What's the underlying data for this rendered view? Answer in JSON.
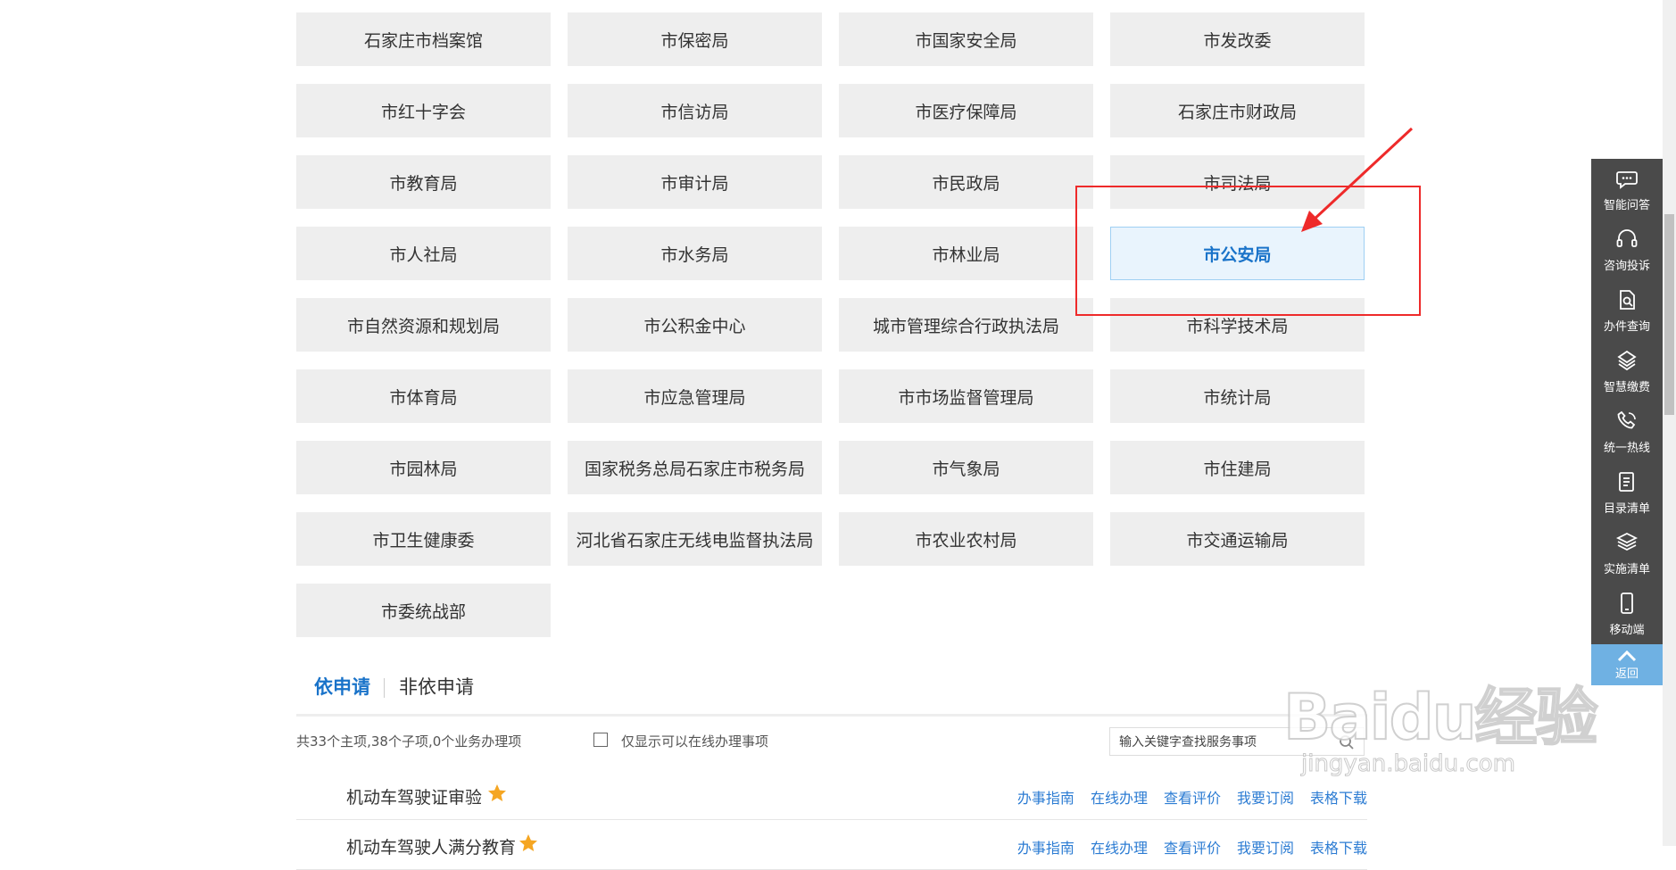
{
  "departments": [
    "石家庄市档案馆",
    "市保密局",
    "市国家安全局",
    "市发改委",
    "市红十字会",
    "市信访局",
    "市医疗保障局",
    "石家庄市财政局",
    "市教育局",
    "市审计局",
    "市民政局",
    "市司法局",
    "市人社局",
    "市水务局",
    "市林业局",
    "市公安局",
    "市自然资源和规划局",
    "市公积金中心",
    "城市管理综合行政执法局",
    "市科学技术局",
    "市体育局",
    "市应急管理局",
    "市市场监督管理局",
    "市统计局",
    "市园林局",
    "国家税务总局石家庄市税务局",
    "市气象局",
    "市住建局",
    "市卫生健康委",
    "河北省石家庄无线电监督执法局",
    "市农业农村局",
    "市交通运输局",
    "市委统战部"
  ],
  "selected_department": "市公安局",
  "tabs": {
    "active": "依申请",
    "inactive": "非依申请"
  },
  "filter": {
    "summary": "共33个主项,38个子项,0个业务办理项",
    "online_only_label": "仅显示可以在线办理事项",
    "online_only_checked": false,
    "search_placeholder": "输入关键字查找服务事项"
  },
  "services": [
    {
      "name": "机动车驾驶证审验",
      "starred": true
    },
    {
      "name": "机动车驾驶人满分教育",
      "starred": true
    }
  ],
  "service_actions": [
    "办事指南",
    "在线办理",
    "查看评价",
    "我要订阅",
    "表格下载"
  ],
  "sidebar": {
    "items": [
      {
        "label": "智能问答",
        "icon": "chat-bubble-icon"
      },
      {
        "label": "咨询投诉",
        "icon": "headset-icon"
      },
      {
        "label": "办件查询",
        "icon": "document-search-icon"
      },
      {
        "label": "智慧缴费",
        "icon": "payment-icon"
      },
      {
        "label": "统一热线",
        "icon": "phone-icon"
      },
      {
        "label": "目录清单",
        "icon": "list-icon"
      },
      {
        "label": "实施清单",
        "icon": "layers-icon"
      },
      {
        "label": "移动端",
        "icon": "mobile-icon"
      }
    ],
    "back_label": "返回"
  },
  "watermark": {
    "logo": "Baidu经验",
    "sub": "jingyan.baidu.com"
  },
  "colors": {
    "accent": "#1a73c9",
    "link": "#2c7cd3",
    "annotation": "#ee2a2a",
    "star": "#f5a623",
    "sidebar": "#4a4a4a"
  }
}
